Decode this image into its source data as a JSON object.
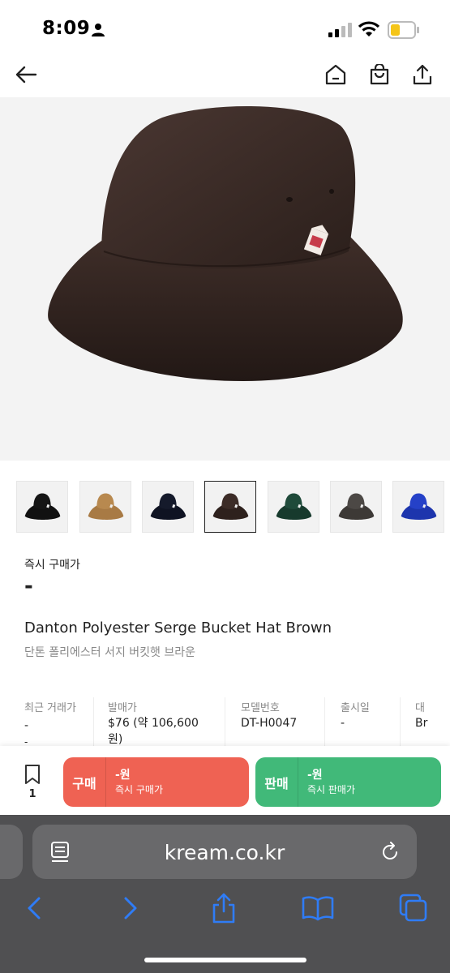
{
  "status_bar": {
    "time": "8:09"
  },
  "nav": {
    "back": "back-arrow",
    "home": "home-icon",
    "bag": "shopping-bag-icon",
    "share": "share-icon"
  },
  "product": {
    "instant_buy_label": "즉시 구매가",
    "instant_buy_price": "-",
    "name_en": "Danton Polyester Serge Bucket Hat Brown",
    "name_ko": "단톤 폴리에스터 서지 버킷햇 브라운"
  },
  "thumbnails": [
    {
      "color": "#151515",
      "band": "#111"
    },
    {
      "color": "#b8894f",
      "band": "#a87a44"
    },
    {
      "color": "#151a2b",
      "band": "#0f1322"
    },
    {
      "color": "#3c2c27",
      "band": "#2e211d",
      "selected": true
    },
    {
      "color": "#1f4a3a",
      "band": "#173a2d"
    },
    {
      "color": "#4c4845",
      "band": "#3d3936"
    },
    {
      "color": "#2541c8",
      "band": "#1d35ad"
    }
  ],
  "specs": {
    "recent_trade_label": "최근 거래가",
    "recent_trade_value1": "-",
    "recent_trade_value2": "-",
    "release_price_label": "발매가",
    "release_price_value": "$76 (약 106,600",
    "release_price_value2": "원)",
    "model_label": "모델번호",
    "model_value": "DT-H0047",
    "release_date_label": "출시일",
    "release_date_value": "-",
    "color_label": "대",
    "color_value": "Br"
  },
  "bottom_bar": {
    "wishlist_count": "1",
    "buy": {
      "tag": "구매",
      "price": "-원",
      "sub": "즉시 구매가"
    },
    "sell": {
      "tag": "판매",
      "price": "-원",
      "sub": "즉시 판매가"
    }
  },
  "browser": {
    "url": "kream.co.kr"
  },
  "colors": {
    "buy": "#ef6253",
    "sell": "#41b979",
    "ios_blue": "#2f7cf6"
  }
}
